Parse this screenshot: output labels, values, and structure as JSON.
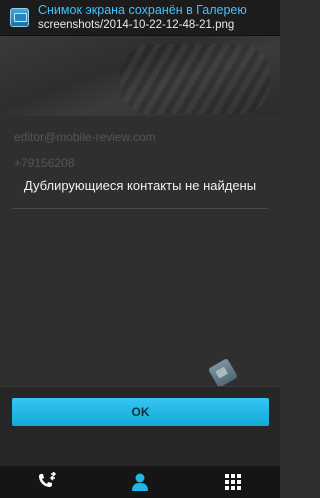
{
  "notification": {
    "title": "Снимок экрана сохранён в Галерею",
    "subtitle": "screenshots/2014-10-22-12-48-21.png",
    "icon": "gallery-icon"
  },
  "background": {
    "email_field": "editor@mobile-review.com",
    "phone_field": "+79156208"
  },
  "dialog": {
    "message": "Дублирующиеся контакты не найдены",
    "ok_label": "OK"
  },
  "nav": {
    "items": [
      {
        "icon": "phone-transfer-icon"
      },
      {
        "icon": "contact-person-icon"
      },
      {
        "icon": "apps-grid-icon"
      }
    ]
  },
  "colors": {
    "accent": "#1fb6e6",
    "notification_title": "#3dc3ff",
    "background": "#2f2f2f"
  }
}
